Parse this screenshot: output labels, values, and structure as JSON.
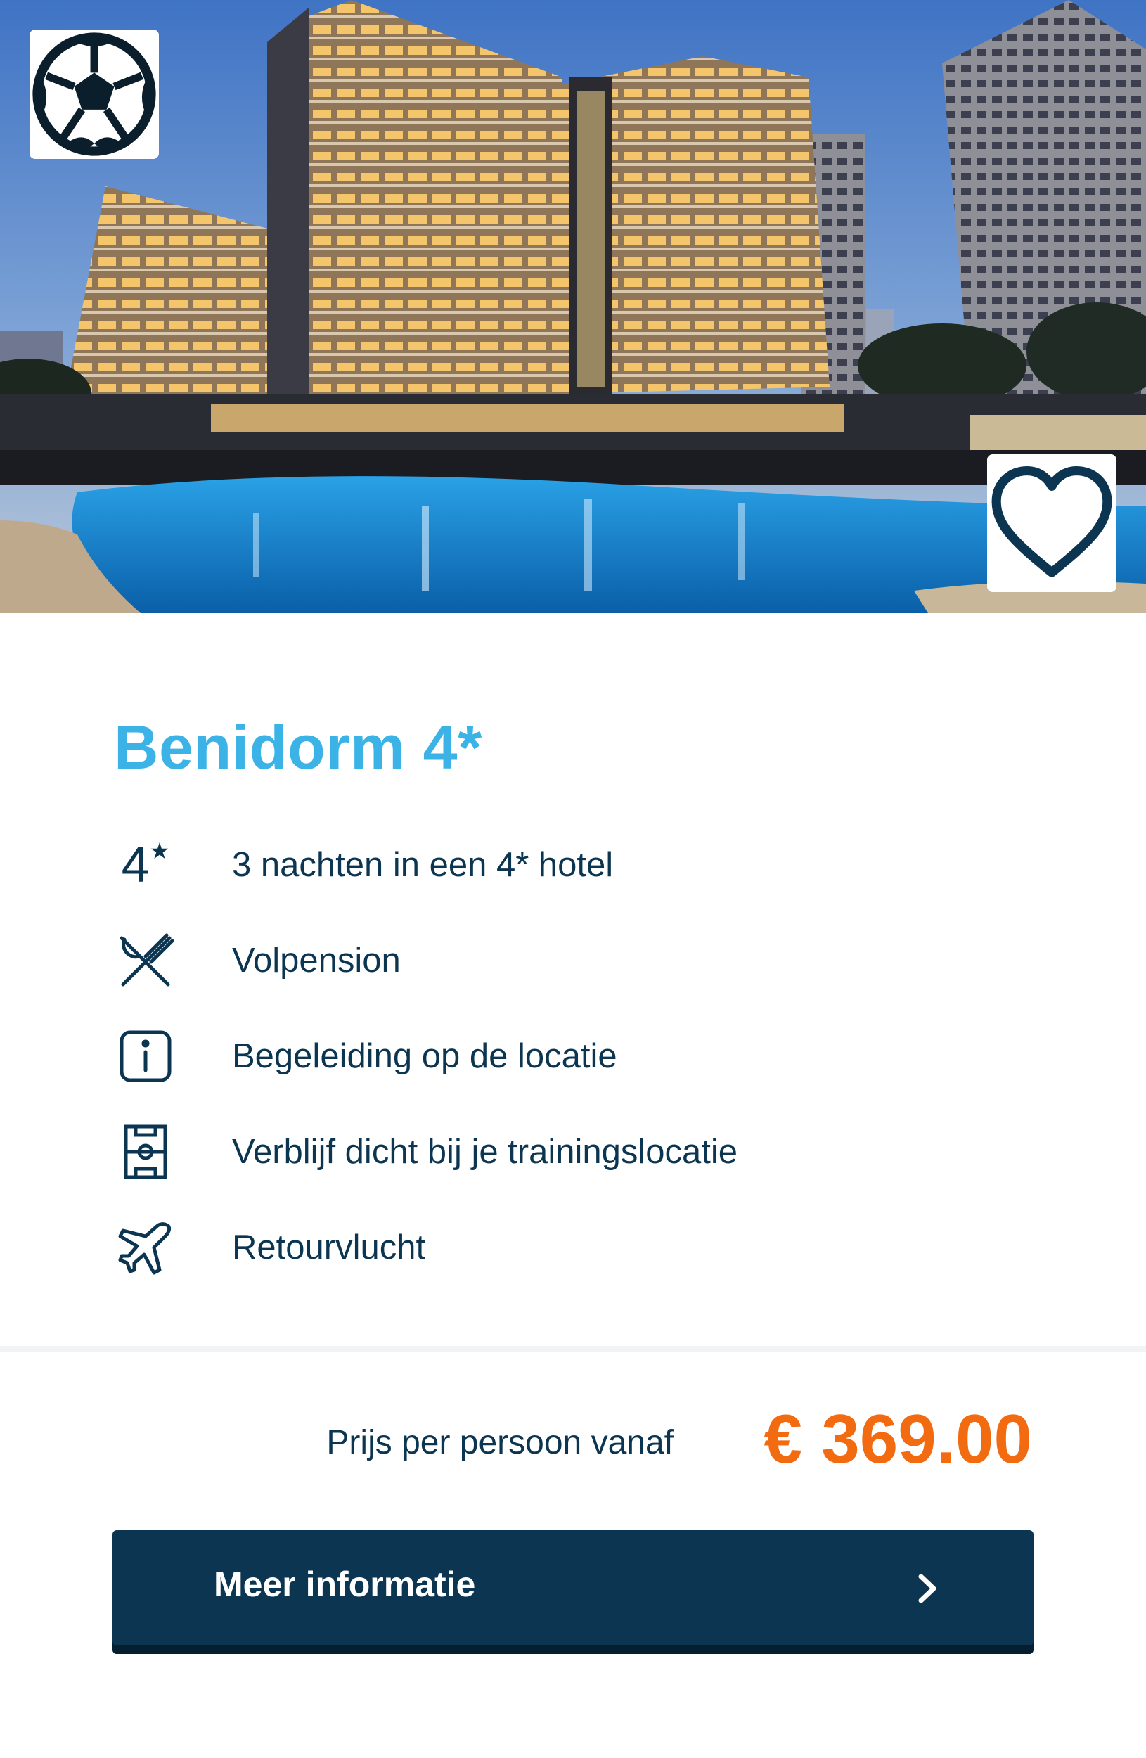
{
  "hero": {
    "sport_icon": "soccer-ball-icon",
    "favorite_icon": "heart-outline-icon"
  },
  "offer": {
    "title": "Benidorm 4*",
    "features": [
      {
        "icon": "four-star-icon",
        "label": "3 nachten in een 4* hotel"
      },
      {
        "icon": "cutlery-icon",
        "label": "Volpension"
      },
      {
        "icon": "info-icon",
        "label": "Begeleiding op de locatie"
      },
      {
        "icon": "pitch-icon",
        "label": "Verblijf dicht bij je trainingslocatie"
      },
      {
        "icon": "plane-icon",
        "label": "Retourvlucht"
      }
    ],
    "four_star_glyph": "4",
    "four_star_mark": "★"
  },
  "pricing": {
    "label": "Prijs per persoon vanaf",
    "value": "€ 369.00"
  },
  "cta": {
    "label": "Meer informatie",
    "icon": "chevron-right-icon"
  },
  "colors": {
    "title": "#3bb3e6",
    "text": "#0b3550",
    "price": "#f36b10",
    "button": "#0b3550"
  }
}
